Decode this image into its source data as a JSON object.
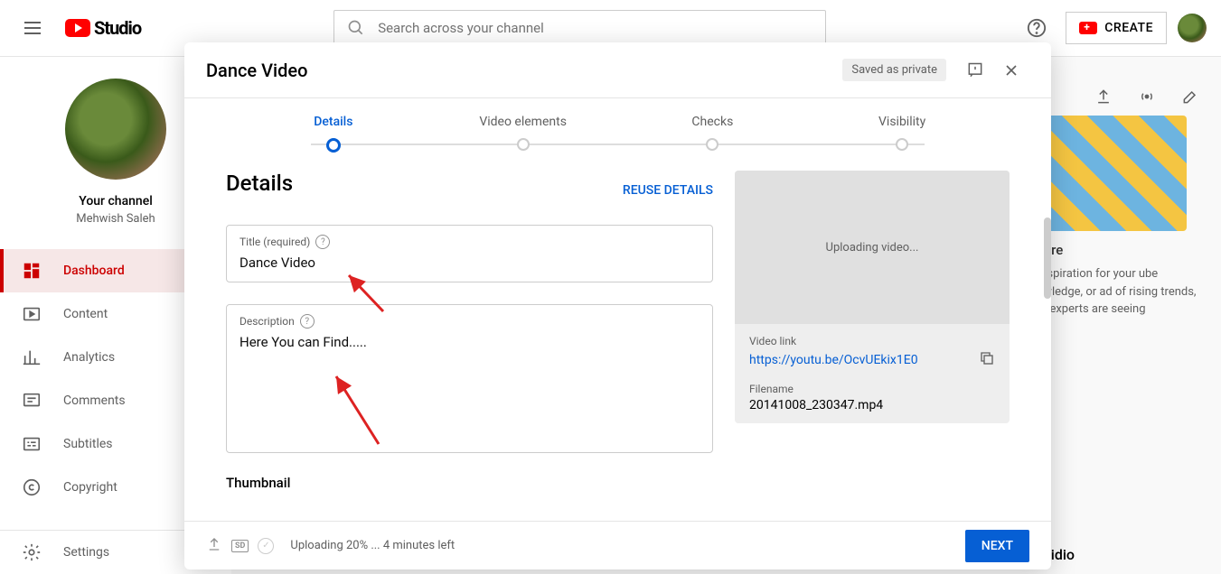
{
  "header": {
    "logo_text": "Studio",
    "search_placeholder": "Search across your channel",
    "create_label": "CREATE"
  },
  "sidebar": {
    "channel_label": "Your channel",
    "channel_name": "Mehwish Saleh",
    "items": [
      {
        "label": "Dashboard",
        "active": true
      },
      {
        "label": "Content"
      },
      {
        "label": "Analytics"
      },
      {
        "label": "Comments"
      },
      {
        "label": "Subtitles"
      },
      {
        "label": "Copyright"
      }
    ],
    "settings_label": "Settings"
  },
  "background": {
    "card_title": "s Here",
    "card_text": "or inspiration for your ube knowledge, or ad of rising trends, here experts are seeing",
    "studio_label": "idio"
  },
  "modal": {
    "title": "Dance Video",
    "saved_badge": "Saved as private",
    "steps": [
      "Details",
      "Video elements",
      "Checks",
      "Visibility"
    ],
    "details_heading": "Details",
    "reuse_label": "REUSE DETAILS",
    "title_field": {
      "label": "Title (required)",
      "value": "Dance Video"
    },
    "desc_field": {
      "label": "Description",
      "value": "Here You can Find....."
    },
    "thumbnail_label": "Thumbnail",
    "preview": {
      "status": "Uploading video...",
      "link_label": "Video link",
      "link_value": "https://youtu.be/OcvUEkix1E0",
      "file_label": "Filename",
      "file_value": "20141008_230347.mp4"
    },
    "footer": {
      "sd": "SD",
      "status": "Uploading 20% ... 4 minutes left",
      "next": "NEXT"
    }
  }
}
